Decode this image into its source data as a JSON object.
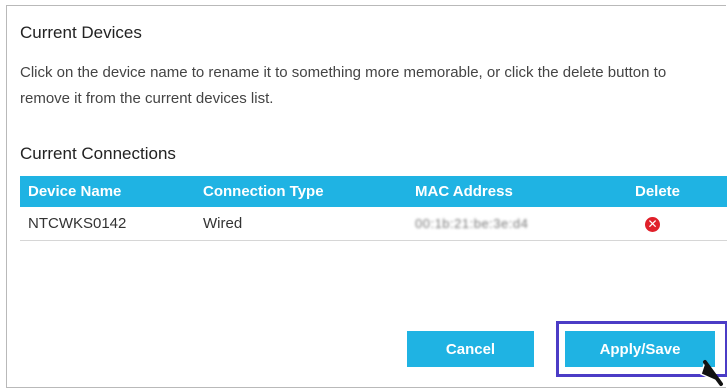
{
  "current_devices": {
    "title": "Current Devices",
    "description": "Click on the device name to rename it to something more memorable, or click the delete button to remove it from the current devices list."
  },
  "current_connections": {
    "title": "Current Connections",
    "columns": {
      "device_name": "Device Name",
      "connection_type": "Connection Type",
      "mac_address": "MAC Address",
      "delete": "Delete"
    },
    "rows": [
      {
        "device_name": "NTCWKS0142",
        "connection_type": "Wired",
        "mac_address": "00:1b:21:be:3e:d4",
        "delete_icon": "delete-x-icon"
      }
    ]
  },
  "buttons": {
    "cancel": "Cancel",
    "apply_save": "Apply/Save"
  },
  "colors": {
    "accent": "#1fb3e3",
    "delete": "#e0202a",
    "highlight": "#4b3cc6"
  }
}
